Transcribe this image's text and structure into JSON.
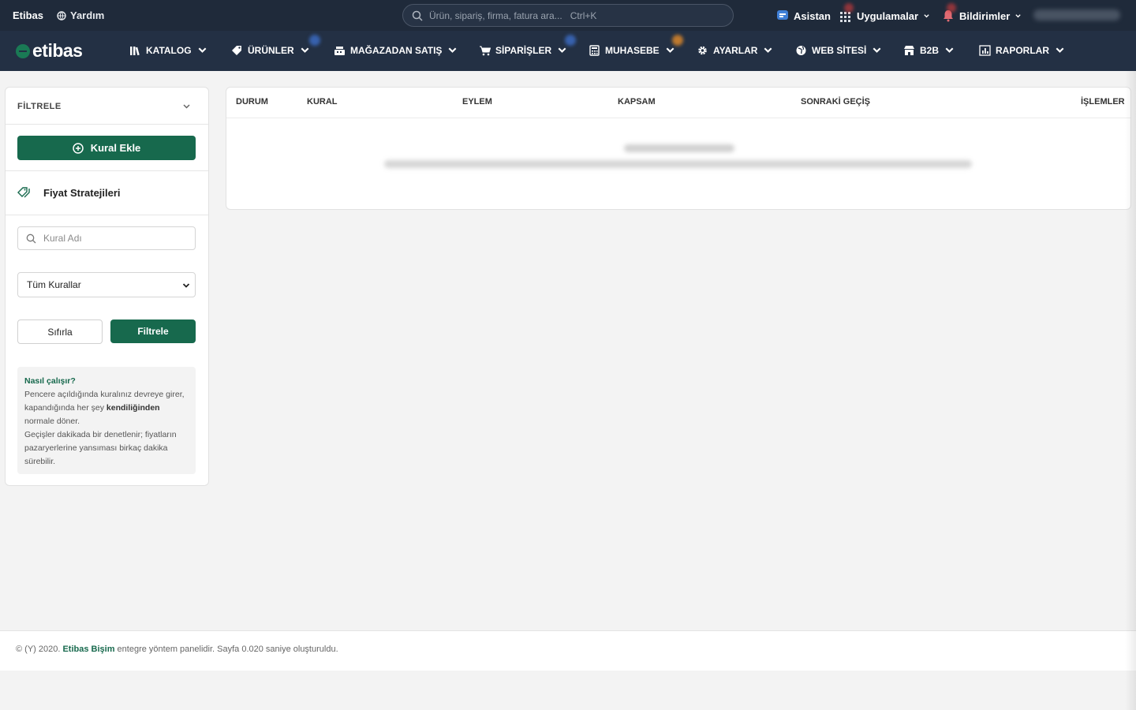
{
  "topbar": {
    "brand": "Etibas",
    "help": "Yardım",
    "search_placeholder": "Ürün, sipariş, firma, fatura ara...   Ctrl+K",
    "assistant": "Asistan",
    "apps": "Uygulamalar",
    "notifications": "Bildirimler"
  },
  "nav": {
    "logo": "etibas",
    "items": [
      {
        "label": "KATALOG",
        "icon": "books-icon"
      },
      {
        "label": "ÜRÜNLER",
        "icon": "tag-icon"
      },
      {
        "label": "MAĞAZADAN SATIŞ",
        "icon": "cash-register-icon"
      },
      {
        "label": "SİPARİŞLER",
        "icon": "cart-icon"
      },
      {
        "label": "MUHASEBE",
        "icon": "calculator-icon"
      },
      {
        "label": "AYARLAR",
        "icon": "gear-icon"
      },
      {
        "label": "WEB SİTESİ",
        "icon": "globe-icon"
      },
      {
        "label": "B2B",
        "icon": "store-icon"
      },
      {
        "label": "RAPORLAR",
        "icon": "chart-icon"
      }
    ]
  },
  "sidebar": {
    "filter_title": "FİLTRELE",
    "add_rule": "Kural Ekle",
    "price_strategies": "Fiyat Stratejileri",
    "search_placeholder": "Kural Adı",
    "select_value": "Tüm Kurallar",
    "reset": "Sıfırla",
    "apply": "Filtrele",
    "info": {
      "title": "Nasıl çalışır?",
      "line1a": "Pencere açıldığında kuralınız devreye girer, kapandığında her şey ",
      "line1b": "kendiliğinden",
      "line1c": " normale döner.",
      "line2": "Geçişler dakikada bir denetlenir; fiyatların pazaryerlerine yansıması birkaç dakika sürebilir."
    }
  },
  "table": {
    "headers": [
      "DURUM",
      "KURAL",
      "EYLEM",
      "KAPSAM",
      "SONRAKİ GEÇİŞ",
      "İŞLEMLER"
    ]
  },
  "footer": {
    "prefix": "© (Y) 2020. ",
    "company": "Etibas Bişim",
    "suffix": " entegre yöntem panelidir. Sayfa 0.020 saniye oluşturuldu."
  },
  "colors": {
    "topbar": "#1f2a3a",
    "navbar": "#233044",
    "primary": "#17694d"
  }
}
